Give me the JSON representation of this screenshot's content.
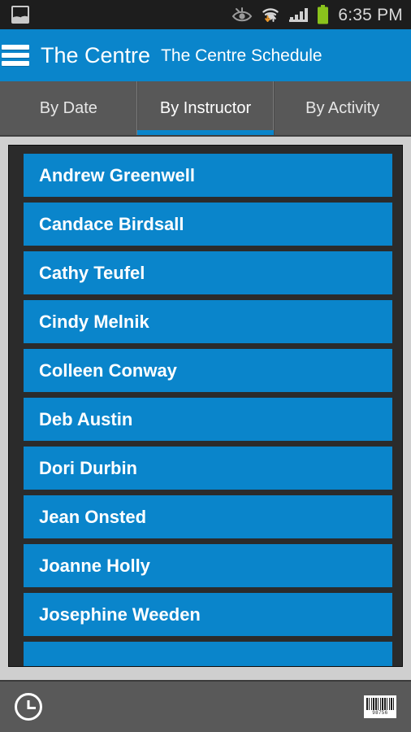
{
  "statusbar": {
    "notification_icon": "gallery-image-icon",
    "icons": [
      "eye-icon",
      "wifi-icon",
      "signal-bars-icon",
      "battery-icon"
    ],
    "time": "6:35 PM",
    "battery_color": "#8ac31c",
    "background": "#1d1d1d"
  },
  "appbar": {
    "menu_icon": "hamburger-menu-icon",
    "title": "The Centre",
    "subtitle": "The Centre Schedule",
    "background": "#0a85cb"
  },
  "tabs": {
    "active_index": 1,
    "items": [
      {
        "label": "By Date"
      },
      {
        "label": "By Instructor"
      },
      {
        "label": "By Activity"
      }
    ],
    "indicator_color": "#0a85cb",
    "background": "#585858"
  },
  "instructor_list": {
    "items": [
      {
        "name": "Andrew Greenwell"
      },
      {
        "name": "Candace Birdsall"
      },
      {
        "name": "Cathy Teufel"
      },
      {
        "name": "Cindy Melnik"
      },
      {
        "name": "Colleen Conway"
      },
      {
        "name": "Deb Austin"
      },
      {
        "name": "Dori Durbin"
      },
      {
        "name": "Jean Onsted"
      },
      {
        "name": "Joanne Holly"
      },
      {
        "name": "Josephine Weeden"
      },
      {
        "name": ""
      }
    ],
    "item_color": "#0a85cb",
    "panel_background": "#2b2b2b"
  },
  "bottombar": {
    "clock_icon": "clock-icon",
    "barcode_icon": "barcode-icon",
    "barcode_digits": "98756",
    "background": "#595959"
  }
}
